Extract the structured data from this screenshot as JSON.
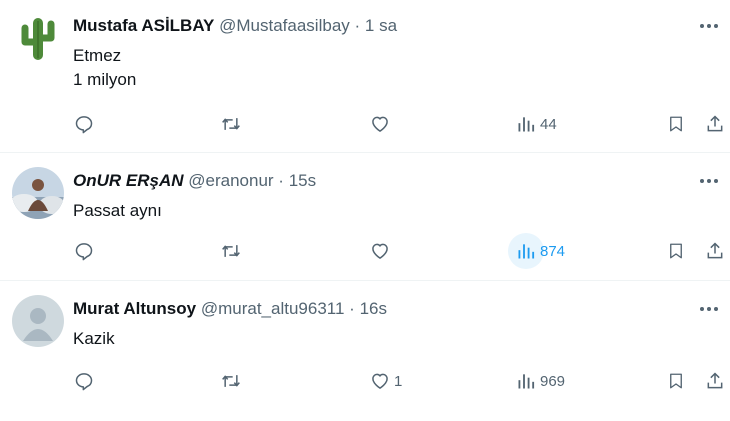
{
  "tweets": [
    {
      "display_name": "Mustafa ASİLBAY",
      "handle": "@Mustafaasilbay",
      "separator": "·",
      "time": "1 sa",
      "text_lines": [
        "Etmez",
        "1 milyon"
      ],
      "likes": "",
      "views": "44"
    },
    {
      "display_name": "OnUR ERşAN",
      "handle": "@eranonur",
      "separator": "·",
      "time": "15s",
      "text_lines": [
        "Passat aynı"
      ],
      "likes": "",
      "views": "874"
    },
    {
      "display_name": "Murat Altunsoy",
      "handle": "@murat_altu96311",
      "separator": "·",
      "time": "16s",
      "text_lines": [
        "Kazik"
      ],
      "likes": "1",
      "views": "969"
    }
  ],
  "colors": {
    "text": "#0f1419",
    "secondary": "#536471",
    "accent": "#1d9bf0",
    "divider": "#eff3f4"
  },
  "icons": [
    "cactus-avatar",
    "photo-avatar",
    "default-avatar",
    "more-icon",
    "reply-icon",
    "retweet-icon",
    "like-icon",
    "views-icon",
    "bookmark-icon",
    "share-icon"
  ]
}
